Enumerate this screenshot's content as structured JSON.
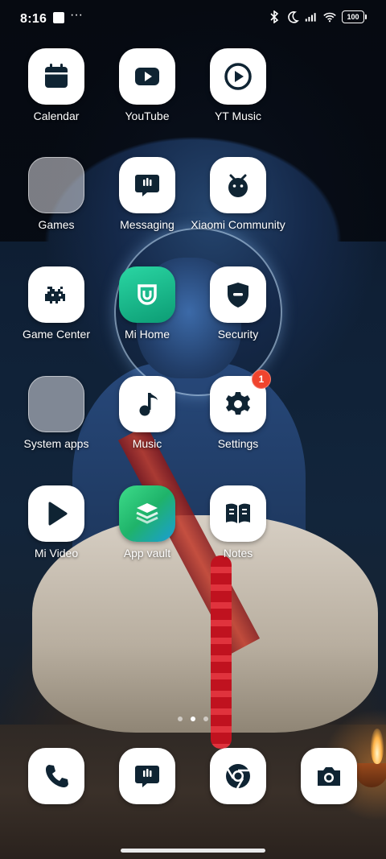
{
  "status_bar": {
    "time": "8:16",
    "more_glyph": "···",
    "battery_level": "100",
    "icons": [
      "bluetooth-icon",
      "dnd-moon-icon",
      "signal-icon",
      "wifi-icon",
      "battery-icon"
    ]
  },
  "apps": [
    {
      "id": "calendar",
      "label": "Calendar",
      "icon": "calendar-icon"
    },
    {
      "id": "youtube",
      "label": "YouTube",
      "icon": "youtube-icon"
    },
    {
      "id": "yt-music",
      "label": "YT Music",
      "icon": "yt-music-icon"
    },
    {
      "id": "games",
      "label": "Games",
      "icon": "folder-icon"
    },
    {
      "id": "messaging",
      "label": "Messaging",
      "icon": "chat-bubble-icon"
    },
    {
      "id": "xiaomi-community",
      "label": "Xiaomi Community",
      "icon": "bunny-icon"
    },
    {
      "id": "game-center",
      "label": "Game Center",
      "icon": "space-invader-icon"
    },
    {
      "id": "mi-home",
      "label": "Mi Home",
      "icon": "mi-home-icon"
    },
    {
      "id": "security",
      "label": "Security",
      "icon": "shield-icon"
    },
    {
      "id": "system-apps",
      "label": "System apps",
      "icon": "folder-icon"
    },
    {
      "id": "music",
      "label": "Music",
      "icon": "music-note-icon"
    },
    {
      "id": "settings",
      "label": "Settings",
      "icon": "gear-icon",
      "badge": "1"
    },
    {
      "id": "mi-video",
      "label": "Mi Video",
      "icon": "play-icon"
    },
    {
      "id": "app-vault",
      "label": "App vault",
      "icon": "layers-icon"
    },
    {
      "id": "notes",
      "label": "Notes",
      "icon": "book-icon"
    }
  ],
  "dock": [
    {
      "id": "phone",
      "icon": "phone-icon"
    },
    {
      "id": "messages",
      "icon": "chat-bubble-icon"
    },
    {
      "id": "chrome",
      "icon": "chrome-icon"
    },
    {
      "id": "camera",
      "icon": "camera-icon"
    }
  ],
  "pages": {
    "count": 3,
    "current": 2
  },
  "colors": {
    "icon_glyph": "#0f2433",
    "badge": "#f0442e",
    "tile": "#ffffff",
    "mi_home": "#1ab988"
  }
}
